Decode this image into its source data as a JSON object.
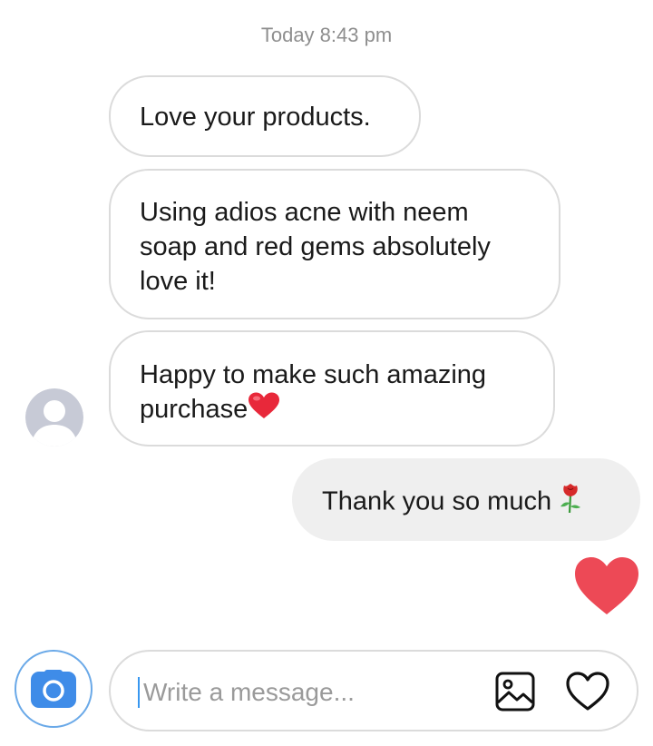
{
  "thread": {
    "timestamp": "Today 8:43 pm"
  },
  "messages": [
    {
      "direction": "incoming",
      "text": "Love your products."
    },
    {
      "direction": "incoming",
      "text": "Using adios acne with neem soap and red gems absolutely love it!"
    },
    {
      "direction": "incoming",
      "text": "Happy to make such amazing purchase",
      "emoji": "red-heart"
    },
    {
      "direction": "outgoing",
      "text": "Thank you so much ",
      "emoji": "rose"
    },
    {
      "direction": "outgoing",
      "reaction": "big-red-heart"
    }
  ],
  "composer": {
    "placeholder": "Write a message...",
    "value": "",
    "camera_icon": "camera-icon",
    "gallery_icon": "image-icon",
    "like_icon": "heart-outline-icon"
  },
  "colors": {
    "accent": "#3897f0",
    "heart": "#ed4956",
    "bubble_border": "#dbdbdb",
    "outgoing_bg": "#efefef"
  }
}
